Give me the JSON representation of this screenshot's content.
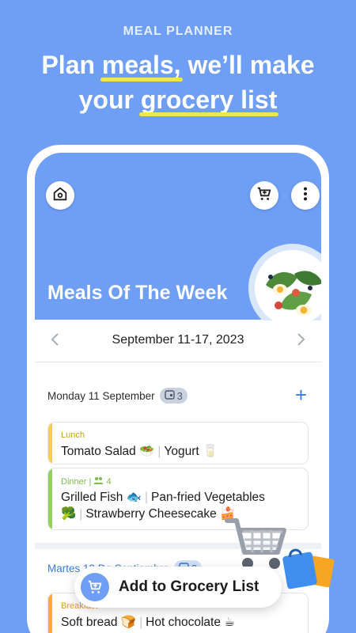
{
  "promo": {
    "eyebrow": "MEAL PLANNER",
    "headline_1": "Plan ",
    "headline_1_highlight": "meals,",
    "headline_2": " we’ll make",
    "headline_3": "your ",
    "headline_3_highlight": "grocery list",
    "highlight_color": "#f4e64a"
  },
  "app": {
    "hero_title": "Meals Of The Week",
    "week_label": "September 11-17, 2023",
    "icons": [
      "home-icon",
      "cart-plus-icon",
      "more-vertical-icon",
      "chevron-left-icon",
      "chevron-right-icon",
      "plus-icon"
    ],
    "days": [
      {
        "title": "Monday 11 September",
        "badge_count": "3",
        "meals": [
          {
            "type": "Lunch",
            "foods": [
              "Tomato Salad 🥗",
              "Yogurt 🥛"
            ],
            "color": "#f6d04d"
          },
          {
            "type": "Dinner |",
            "servings": "4",
            "foods": [
              "Grilled Fish 🐟",
              "Pan-fried Vegetables 🥦",
              "Strawberry Cheesecake 🍰"
            ],
            "color": "#93cf63"
          }
        ]
      },
      {
        "title": "Martes 12 De Septiembre",
        "badge_count": "3",
        "meals": [
          {
            "type": "Breakfast",
            "foods": [
              "Soft bread 🍞",
              "Hot chocolate ☕"
            ],
            "color": "#f6ab3d"
          }
        ]
      }
    ],
    "add_grocery_label": "Add to Grocery List",
    "accent_color": "#6f9ef5"
  }
}
